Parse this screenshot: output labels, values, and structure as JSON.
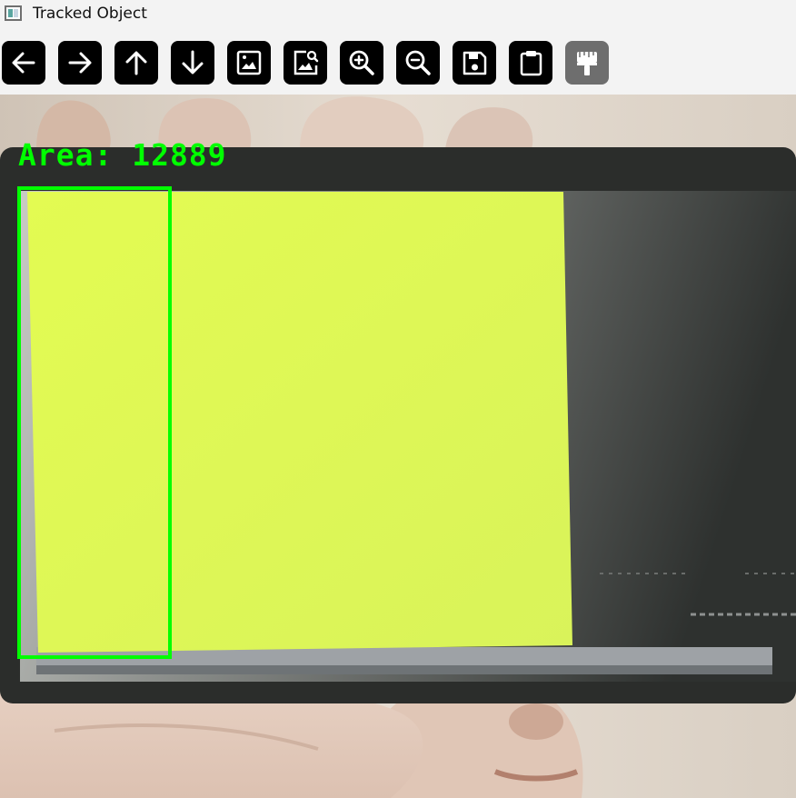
{
  "window": {
    "title": "Tracked Object",
    "app_icon": "window-app-icon"
  },
  "toolbar": {
    "buttons": [
      {
        "name": "pan-left-button",
        "icon": "arrow-left-icon"
      },
      {
        "name": "pan-right-button",
        "icon": "arrow-right-icon"
      },
      {
        "name": "pan-up-button",
        "icon": "arrow-up-icon"
      },
      {
        "name": "pan-down-button",
        "icon": "arrow-down-icon"
      },
      {
        "name": "zoom-fit-button",
        "icon": "image-icon"
      },
      {
        "name": "zoom-actual-button",
        "icon": "image-search-icon"
      },
      {
        "name": "zoom-in-button",
        "icon": "zoom-in-icon"
      },
      {
        "name": "zoom-out-button",
        "icon": "zoom-out-icon"
      },
      {
        "name": "save-button",
        "icon": "floppy-disk-icon"
      },
      {
        "name": "copy-clipboard-button",
        "icon": "clipboard-icon"
      },
      {
        "name": "properties-button",
        "icon": "paint-brush-icon",
        "disabled": true
      }
    ]
  },
  "overlay": {
    "label": "Area: 12889",
    "color": "#00ff00"
  }
}
